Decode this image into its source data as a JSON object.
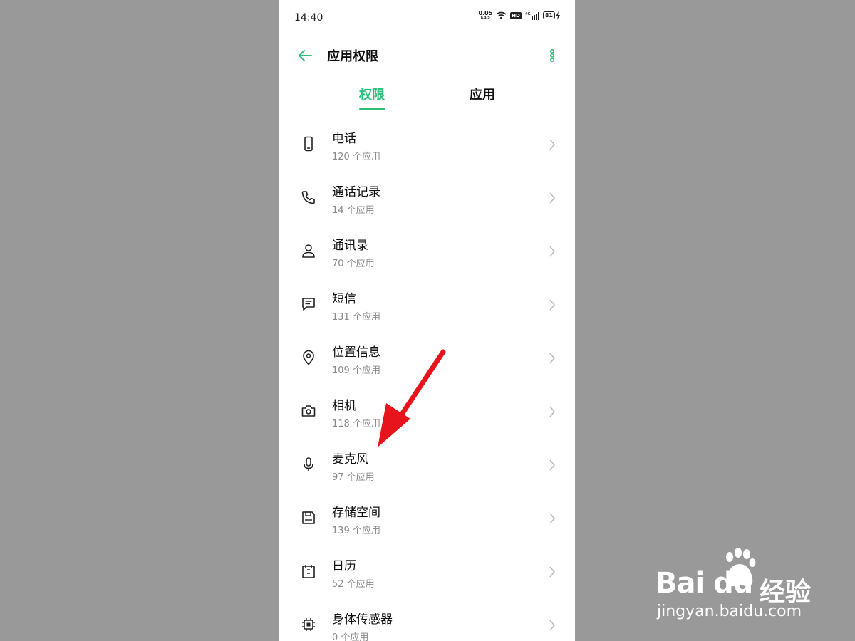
{
  "status": {
    "time": "14:40",
    "net_speed": "0.05",
    "net_unit": "KB/S",
    "hd": "HD",
    "signal": "4G",
    "battery": "81"
  },
  "appbar": {
    "title": "应用权限"
  },
  "tabs": [
    {
      "label": "权限"
    },
    {
      "label": "应用"
    }
  ],
  "accent_color": "#2fbe7a",
  "permissions": [
    {
      "name": "电话",
      "count": "120 个应用",
      "icon": "phone-icon"
    },
    {
      "name": "通话记录",
      "count": "14 个应用",
      "icon": "call-log-icon"
    },
    {
      "name": "通讯录",
      "count": "70 个应用",
      "icon": "contacts-icon"
    },
    {
      "name": "短信",
      "count": "131 个应用",
      "icon": "sms-icon"
    },
    {
      "name": "位置信息",
      "count": "109 个应用",
      "icon": "location-icon"
    },
    {
      "name": "相机",
      "count": "118 个应用",
      "icon": "camera-icon"
    },
    {
      "name": "麦克风",
      "count": "97 个应用",
      "icon": "microphone-icon"
    },
    {
      "name": "存储空间",
      "count": "139 个应用",
      "icon": "storage-icon"
    },
    {
      "name": "日历",
      "count": "52 个应用",
      "icon": "calendar-icon"
    },
    {
      "name": "身体传感器",
      "count": "0 个应用",
      "icon": "body-sensor-icon"
    }
  ],
  "watermark": {
    "brand": "Bai du",
    "product": "经验",
    "url": "jingyan.baidu.com"
  }
}
